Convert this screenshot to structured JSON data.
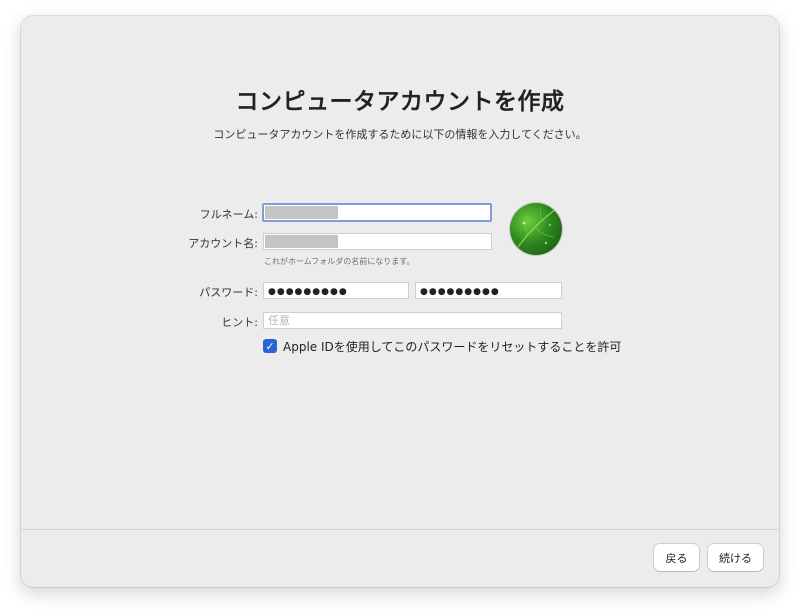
{
  "page": {
    "title": "コンピュータアカウントを作成",
    "subtitle": "コンピュータアカウントを作成するために以下の情報を入力してください。"
  },
  "form": {
    "fullname_label": "フルネーム:",
    "account_label": "アカウント名:",
    "account_hint": "これがホームフォルダの名前になります。",
    "password_label": "パスワード:",
    "password_value": "●●●●●●●●●",
    "verify_value": "●●●●●●●●●",
    "hint_label": "ヒント:",
    "hint_placeholder": "任意",
    "apple_id_checkbox_label": "Apple IDを使用してこのパスワードをリセットすることを許可",
    "apple_id_checked": true
  },
  "avatar": {
    "icon": "leaf-photo"
  },
  "footer": {
    "back_label": "戻る",
    "continue_label": "続ける"
  },
  "colors": {
    "window_bg": "#ececec",
    "accent": "#2a63d6",
    "focus_ring": "#7f9ed8"
  }
}
